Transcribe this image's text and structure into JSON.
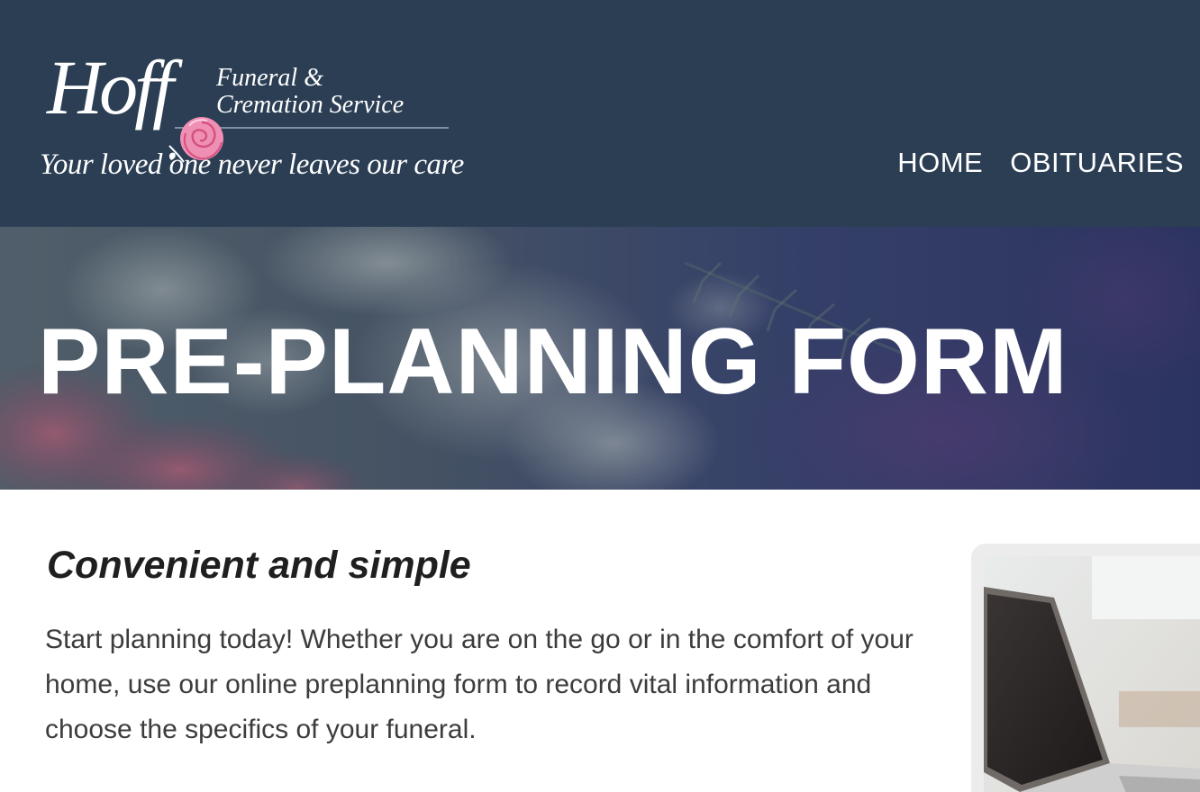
{
  "brand": {
    "name": "Hoff",
    "subtitle_line1": "Funeral &",
    "subtitle_line2": "Cremation Service",
    "tagline": "Your loved one never leaves our care",
    "colors": {
      "header_bg": "#2b3e54",
      "rose": "#f08fb4"
    }
  },
  "nav": {
    "items": [
      {
        "label": "HOME"
      },
      {
        "label": "OBITUARIES"
      }
    ]
  },
  "hero": {
    "title": "PRE-PLANNING FORM"
  },
  "content": {
    "heading": "Convenient and simple",
    "body": "Start planning today! Whether you are on the go or in the comfort of your home, use our online preplanning form to record vital information and choose the specifics of your funeral."
  },
  "icons": [
    "rose-icon"
  ]
}
